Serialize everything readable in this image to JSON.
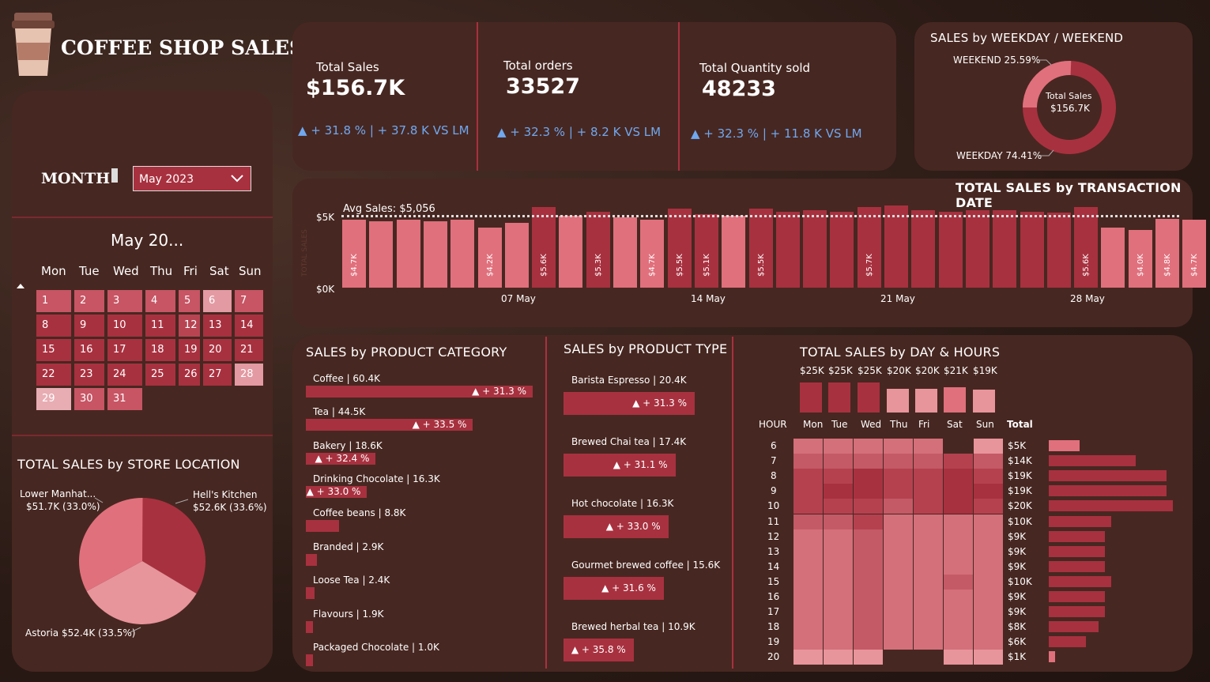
{
  "header": {
    "title": "COFFEE SHOP SALES"
  },
  "filter": {
    "month_label": "MONTH",
    "month_value": "May 2023"
  },
  "calendar": {
    "title": "May 20...",
    "weekdays": [
      "Mon",
      "Tue",
      "Wed",
      "Thu",
      "Fri",
      "Sat",
      "Sun"
    ],
    "days": [
      "1",
      "2",
      "3",
      "4",
      "5",
      "6",
      "7",
      "8",
      "9",
      "10",
      "11",
      "12",
      "13",
      "14",
      "15",
      "16",
      "17",
      "18",
      "19",
      "20",
      "21",
      "22",
      "23",
      "24",
      "25",
      "26",
      "27",
      "28",
      "29",
      "30",
      "31"
    ]
  },
  "kpis": [
    {
      "label": "Total Sales",
      "value": "$156.7K",
      "delta": "▲ + 31.8 % | + 37.8 K  VS LM"
    },
    {
      "label": "Total orders",
      "value": "33527",
      "delta": "▲ + 32.3 % | + 8.2 K  VS LM"
    },
    {
      "label": "Total Quantity sold",
      "value": "48233",
      "delta": "▲ + 32.3 % | + 11.8 K  VS LM"
    }
  ],
  "weekday_donut": {
    "title": "SALES by WEEKDAY / WEEKEND",
    "weekend_label": "WEEKEND 25.59%",
    "weekday_label": "WEEKDAY 74.41%",
    "center_title": "Total Sales",
    "center_value": "$156.7K",
    "weekend_pct": 25.59,
    "weekday_pct": 74.41,
    "colors": {
      "weekday": "#a8313f",
      "weekend": "#e0707c"
    }
  },
  "trans_chart": {
    "title": "TOTAL SALES by TRANSACTION DATE",
    "avg_label": "Avg Sales: $5,056",
    "y_axis_title": "TOTAL SALES",
    "y_ticks": [
      "$5K",
      "$0K"
    ],
    "x_ticks": [
      "07 May",
      "14 May",
      "21 May",
      "28 May"
    ]
  },
  "chart_data": {
    "type": "bar",
    "title": "TOTAL SALES by TRANSACTION DATE",
    "categories": [
      "1",
      "2",
      "3",
      "4",
      "5",
      "6",
      "7",
      "8",
      "9",
      "10",
      "11",
      "12",
      "13",
      "14",
      "15",
      "16",
      "17",
      "18",
      "19",
      "20",
      "21",
      "22",
      "23",
      "24",
      "25",
      "26",
      "27",
      "28",
      "29",
      "30",
      "31"
    ],
    "values": [
      4.7,
      4.6,
      4.7,
      4.6,
      4.7,
      4.2,
      4.5,
      5.6,
      5.0,
      5.3,
      4.9,
      4.7,
      5.5,
      5.1,
      5.0,
      5.5,
      5.3,
      5.4,
      5.3,
      5.6,
      5.7,
      5.4,
      5.3,
      5.4,
      5.4,
      5.3,
      5.2,
      5.6,
      4.2,
      4.0,
      4.8,
      4.7
    ],
    "labels": [
      "$4.7K",
      "",
      "",
      "",
      "",
      "$4.2K",
      "",
      "$5.6K",
      "",
      "$5.3K",
      "",
      "$4.7K",
      "$5.5K",
      "$5.1K",
      "",
      "$5.5K",
      "",
      "",
      "",
      "$5.7K",
      "",
      "",
      "",
      "",
      "",
      "",
      "",
      "$5.6K",
      "",
      "$4.0K",
      "$4.8K",
      "$4.7K"
    ],
    "avg": 5.056,
    "ylim": [
      0,
      5.5
    ],
    "ylabel": "TOTAL SALES",
    "colors": {
      "above": "#a8313f",
      "below": "#e0707c"
    }
  },
  "store_location": {
    "title": "TOTAL SALES by STORE LOCATION",
    "slices": [
      {
        "name": "Hell's Kitchen",
        "label": "$52.6K (33.6%)",
        "pct": 33.6,
        "color": "#a8313f"
      },
      {
        "name": "Astoria",
        "label": "$52.4K (33.5%)",
        "pct": 33.5,
        "color": "#e8949b"
      },
      {
        "name": "Lower Manhat...",
        "label": "$51.7K (33.0%)",
        "pct": 33.0,
        "color": "#e0707c"
      }
    ]
  },
  "product_category": {
    "title": "SALES by PRODUCT CATEGORY",
    "items": [
      {
        "label": "Coffee | 60.4K",
        "value": 60.4,
        "delta": "▲ + 31.3 %"
      },
      {
        "label": "Tea | 44.5K",
        "value": 44.5,
        "delta": "▲ + 33.5 %"
      },
      {
        "label": "Bakery | 18.6K",
        "value": 18.6,
        "delta": "▲ + 32.4 %"
      },
      {
        "label": "Drinking Chocolate | 16.3K",
        "value": 16.3,
        "delta": "▲ + 33.0 %"
      },
      {
        "label": "Coffee beans | 8.8K",
        "value": 8.8,
        "delta": ""
      },
      {
        "label": "Branded | 2.9K",
        "value": 2.9,
        "delta": ""
      },
      {
        "label": "Loose Tea | 2.4K",
        "value": 2.4,
        "delta": ""
      },
      {
        "label": "Flavours | 1.9K",
        "value": 1.9,
        "delta": ""
      },
      {
        "label": "Packaged Chocolate | 1.0K",
        "value": 1.0,
        "delta": ""
      }
    ]
  },
  "product_type": {
    "title": "SALES by PRODUCT TYPE",
    "items": [
      {
        "label": "Barista Espresso | 20.4K",
        "value": 20.4,
        "delta": "▲ + 31.3 %"
      },
      {
        "label": "Brewed Chai tea | 17.4K",
        "value": 17.4,
        "delta": "▲ + 31.1 %"
      },
      {
        "label": "Hot chocolate | 16.3K",
        "value": 16.3,
        "delta": "▲ + 33.0 %"
      },
      {
        "label": "Gourmet brewed coffee | 15.6K",
        "value": 15.6,
        "delta": "▲ + 31.6 %"
      },
      {
        "label": "Brewed herbal tea | 10.9K",
        "value": 10.9,
        "delta": "▲ + 35.8 %"
      }
    ]
  },
  "day_hours": {
    "title": "TOTAL SALES by DAY & HOURS",
    "hour_header": "HOUR",
    "total_header": "Total",
    "days": [
      "Mon",
      "Tue",
      "Wed",
      "Thu",
      "Fri",
      "Sat",
      "Sun"
    ],
    "day_totals": [
      "$25K",
      "$25K",
      "$25K",
      "$20K",
      "$20K",
      "$21K",
      "$19K"
    ],
    "day_values": [
      25,
      25,
      25,
      20,
      20,
      21,
      19
    ],
    "hours": [
      "6",
      "7",
      "8",
      "9",
      "10",
      "11",
      "12",
      "13",
      "14",
      "15",
      "16",
      "17",
      "18",
      "19",
      "20"
    ],
    "hour_totals": [
      "$5K",
      "$14K",
      "$19K",
      "$19K",
      "$20K",
      "$10K",
      "$9K",
      "$9K",
      "$9K",
      "$10K",
      "$9K",
      "$9K",
      "$8K",
      "$6K",
      "$1K"
    ],
    "hour_values": [
      5,
      14,
      19,
      19,
      20,
      10,
      9,
      9,
      9,
      10,
      9,
      9,
      8,
      6,
      1
    ]
  }
}
